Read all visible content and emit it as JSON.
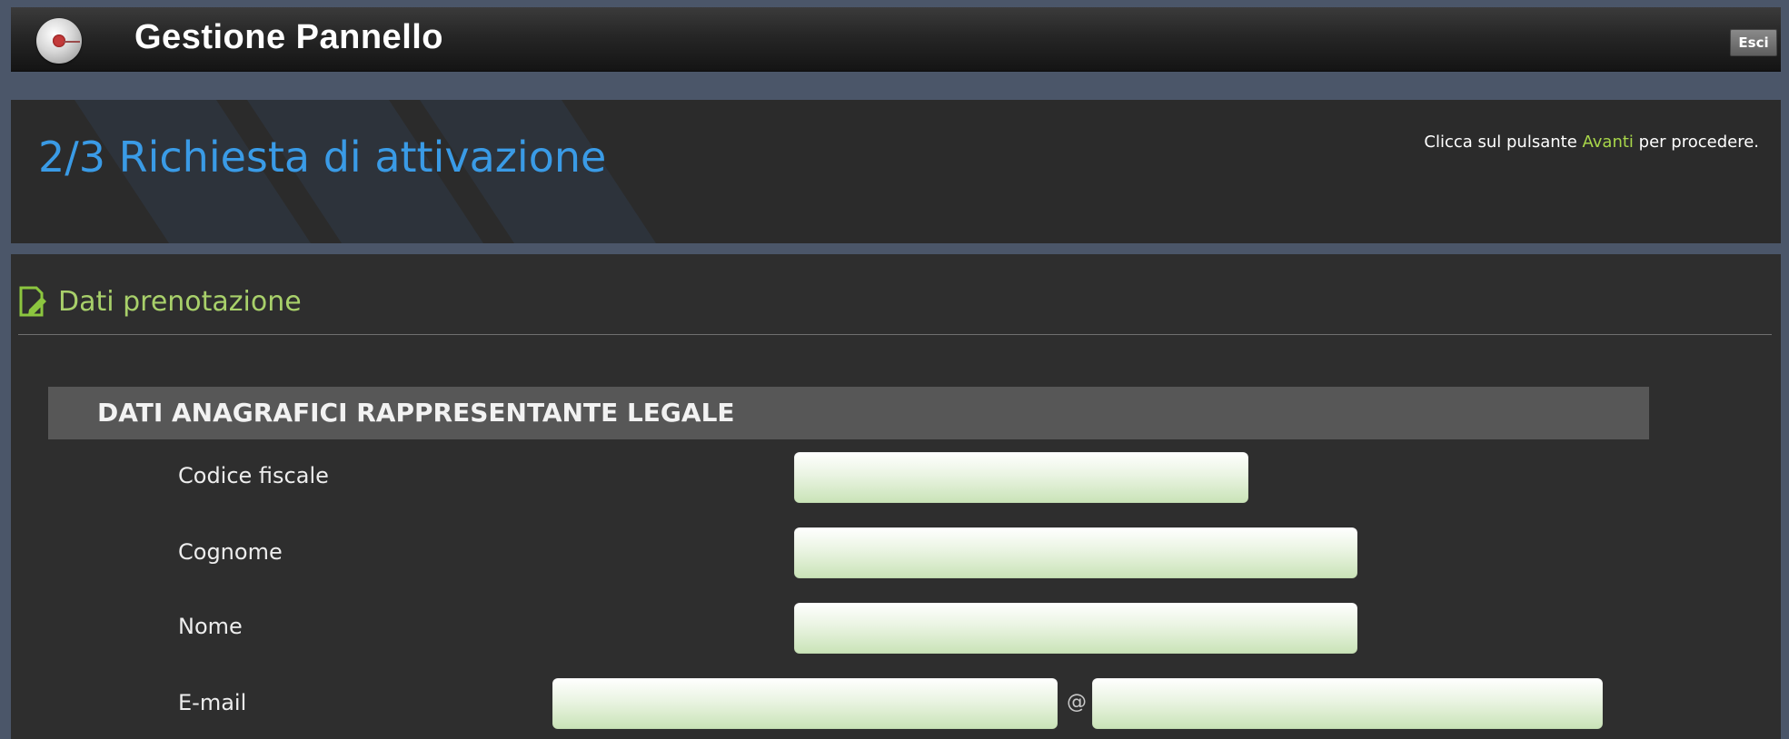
{
  "header": {
    "title": "Gestione Pannello",
    "exit_label": "Esci"
  },
  "step": {
    "title": "2/3 Richiesta di attivazione",
    "hint_before": "Clicca sul pulsante ",
    "hint_accent": "Avanti",
    "hint_after": " per procedere."
  },
  "section": {
    "title": "Dati prenotazione"
  },
  "group": {
    "title": "DATI ANAGRAFICI RAPPRESENTANTE LEGALE",
    "fields": [
      {
        "label": "Codice fiscale",
        "value": ""
      },
      {
        "label": "Cognome",
        "value": ""
      },
      {
        "label": "Nome",
        "value": ""
      },
      {
        "label": "E-mail",
        "user_value": "",
        "domain_value": "",
        "separator": "@"
      }
    ]
  },
  "colors": {
    "step_title": "#3a9be6",
    "section_title": "#a8d06a",
    "accent": "#a8d64a"
  },
  "icons": {
    "logo": "target-logo-icon",
    "section": "edit-document-icon"
  }
}
